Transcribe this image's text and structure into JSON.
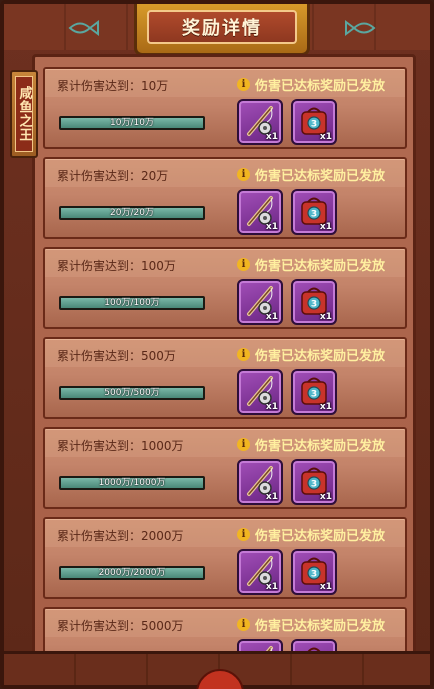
{
  "title": "奖励详情",
  "side_tab": "咸鱼之王",
  "status_text": "伤害已达标奖励已发放",
  "info_icon": "i",
  "colors": {
    "accent": "#d79a2a",
    "status": "#fff0a0",
    "progress": "#4a8878"
  },
  "rewards": [
    {
      "condition": "累计伤害达到：10万",
      "progress": "10万/10万",
      "items": [
        {
          "icon": "fishing-rod-icon",
          "qty": "x1"
        },
        {
          "icon": "red-bag-icon",
          "qty": "x1"
        }
      ]
    },
    {
      "condition": "累计伤害达到：20万",
      "progress": "20万/20万",
      "items": [
        {
          "icon": "fishing-rod-icon",
          "qty": "x1"
        },
        {
          "icon": "red-bag-icon",
          "qty": "x1"
        }
      ]
    },
    {
      "condition": "累计伤害达到：100万",
      "progress": "100万/100万",
      "items": [
        {
          "icon": "fishing-rod-icon",
          "qty": "x1"
        },
        {
          "icon": "red-bag-icon",
          "qty": "x1"
        }
      ]
    },
    {
      "condition": "累计伤害达到：500万",
      "progress": "500万/500万",
      "items": [
        {
          "icon": "fishing-rod-icon",
          "qty": "x1"
        },
        {
          "icon": "red-bag-icon",
          "qty": "x1"
        }
      ]
    },
    {
      "condition": "累计伤害达到：1000万",
      "progress": "1000万/1000万",
      "items": [
        {
          "icon": "fishing-rod-icon",
          "qty": "x1"
        },
        {
          "icon": "red-bag-icon",
          "qty": "x1"
        }
      ]
    },
    {
      "condition": "累计伤害达到：2000万",
      "progress": "2000万/2000万",
      "items": [
        {
          "icon": "fishing-rod-icon",
          "qty": "x1"
        },
        {
          "icon": "red-bag-icon",
          "qty": "x1"
        }
      ]
    },
    {
      "condition": "累计伤害达到：5000万",
      "progress": "",
      "items": [
        {
          "icon": "fishing-rod-icon",
          "qty": ""
        },
        {
          "icon": "red-bag-icon",
          "qty": ""
        }
      ]
    }
  ]
}
